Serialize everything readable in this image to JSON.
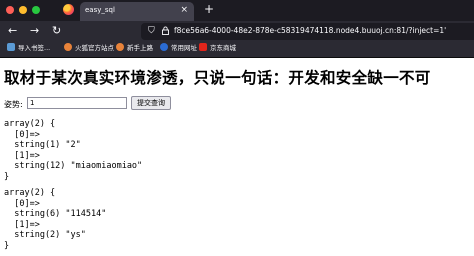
{
  "browser": {
    "tab_title": "easy_sql",
    "url": "f8ce56a6-4000-48e2-878e-c58319474118.node4.buuoj.cn:81/?inject=1'",
    "bookmarks": [
      "导入书签...",
      "火狐官方站点",
      "新手上路",
      "常用网址",
      "京东商城"
    ]
  },
  "page": {
    "heading": "取材于某次真实环境渗透，只说一句话：开发和安全缺一不可",
    "form_label": "姿势:",
    "inject_value": "1",
    "submit_label": "提交查询",
    "results": [
      "array(2) {\n  [0]=>\n  string(1) \"2\"\n  [1]=>\n  string(12) \"miaomiaomiao\"\n}",
      "array(2) {\n  [0]=>\n  string(6) \"114514\"\n  [1]=>\n  string(2) \"ys\"\n}"
    ]
  },
  "colors": {
    "tabbar": "#1c1b22",
    "toolbar": "#2b2a33",
    "active_tab": "#42414d",
    "chrome_text": "#fbfbfe"
  }
}
